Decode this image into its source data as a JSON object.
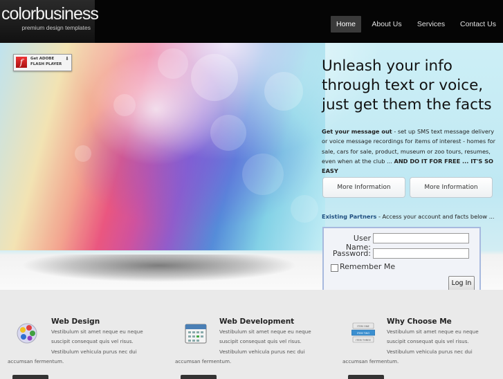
{
  "brand": {
    "name": "colorbusiness",
    "tagline": "premium design templates"
  },
  "nav": {
    "items": [
      "Home",
      "About Us",
      "Services",
      "Contact Us"
    ],
    "active": "Home"
  },
  "flash_badge": {
    "line1": "Get ADOBE",
    "line2": "FLASH PLAYER"
  },
  "hero": {
    "headline_lines": [
      "Unleash your info",
      "through text or voice,",
      "just get them the facts"
    ],
    "intro_bold": "Get your message out",
    "intro_text": " - set up SMS text message delivery or voice message recordings for items of interest - homes for sale, cars for sale, product, museum or zoo tours, resumes, even when at the club ... ",
    "intro_emph": "AND DO IT FOR FREE ... IT'S SO EASY",
    "buttons": [
      "More Information",
      "More Information"
    ],
    "partners_bold": "Existing Partners",
    "partners_text": " - Access your account and facts below ..."
  },
  "login": {
    "username_label": "User Name:",
    "password_label": "Password:",
    "remember_label": "Remember Me",
    "remember_checked": false,
    "button_label": "Log In"
  },
  "features": [
    {
      "title": "Web Design",
      "icon": "palette-icon",
      "line1": "Vestibulum sit amet neque eu neque",
      "line2": "suscipit consequat quis vel risus.",
      "line3": "Vestibulum vehicula purus nec dui",
      "line4": "accumsan fermentum."
    },
    {
      "title": "Web Development",
      "icon": "calendar-icon",
      "line1": "Vestibulum sit amet neque eu neque",
      "line2": "suscipit consequat quis vel risus.",
      "line3": "Vestibulum vehicula purus nec dui",
      "line4": "accumsan fermentum."
    },
    {
      "title": "Why Choose Me",
      "icon": "list-icon",
      "line1": "Vestibulum sit amet neque eu neque",
      "line2": "suscipit consequat quis vel risus.",
      "line3": "Vestibulum vehicula purus nec dui",
      "line4": "accumsan fermentum.",
      "icon_labels": [
        "ITEM ONE",
        "ITEM TWO",
        "ITEM THREE"
      ]
    }
  ]
}
